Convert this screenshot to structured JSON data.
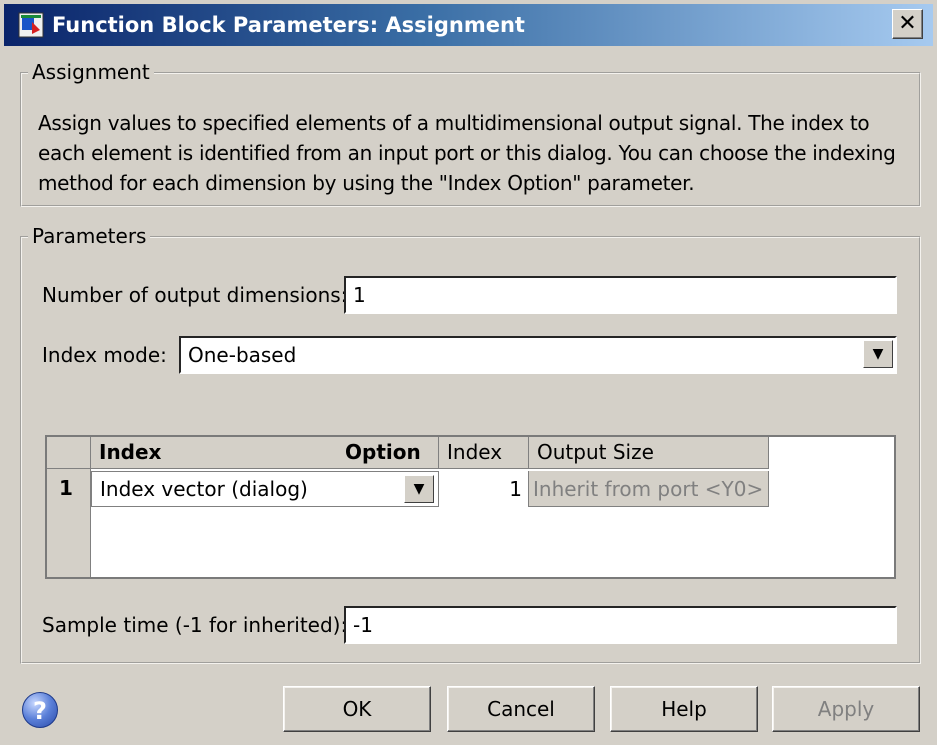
{
  "window": {
    "title": "Function Block Parameters: Assignment",
    "close_glyph": "✕"
  },
  "assignment_group": {
    "label": "Assignment",
    "description": "Assign values to specified elements of a multidimensional output signal. The index to each element is identified from an input port or this dialog. You can choose the indexing method for each dimension by using the \"Index Option\" parameter."
  },
  "parameters_group": {
    "label": "Parameters",
    "num_dims_label": "Number of output dimensions:",
    "num_dims_value": "1",
    "index_mode_label": "Index mode:",
    "index_mode_value": "One-based",
    "sample_time_label": "Sample time (-1 for inherited):",
    "sample_time_value": "-1"
  },
  "table": {
    "headers": [
      "Index",
      "Option",
      "Index",
      "Output Size"
    ],
    "rows": [
      {
        "num": "1",
        "option": "Index vector (dialog)",
        "index": "1",
        "output_size": "Inherit from port <Y0>"
      }
    ]
  },
  "buttons": {
    "help_glyph": "?",
    "ok": "OK",
    "cancel": "Cancel",
    "help": "Help",
    "apply": "Apply"
  },
  "colors": {
    "title_gradient_start": "#0a246a",
    "title_gradient_end": "#a6caf0",
    "disabled_text": "#808080"
  },
  "icons": {
    "app": "simulink-block-icon",
    "dropdown": "chevron-down-icon",
    "help": "question-icon"
  }
}
